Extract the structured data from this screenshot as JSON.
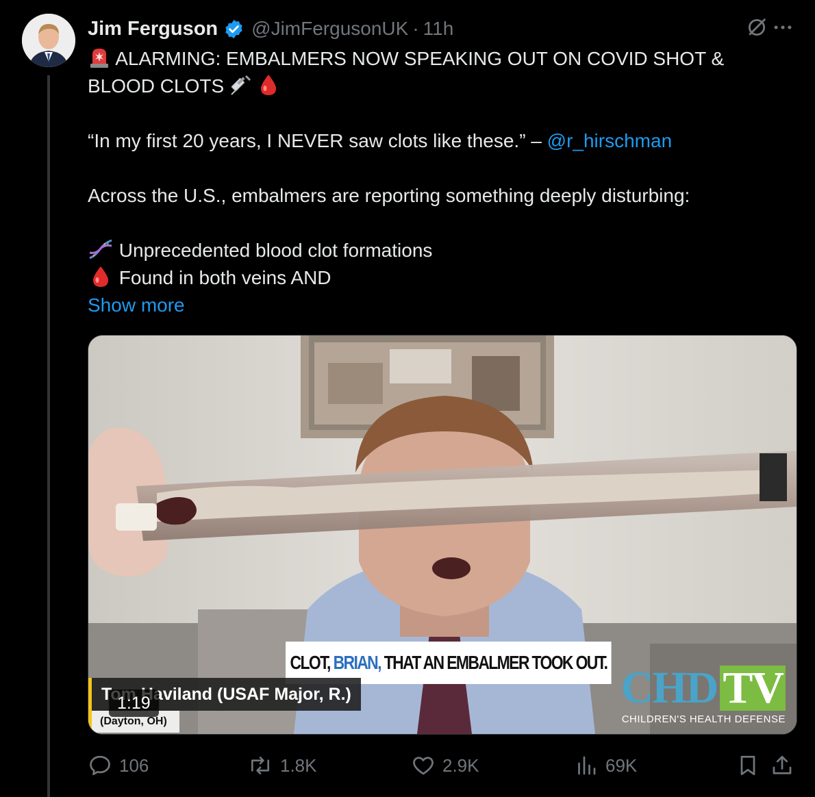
{
  "author": {
    "name": "Jim Ferguson",
    "handle": "@JimFergusonUK",
    "separator": "·",
    "time": "11h",
    "verified": true
  },
  "tweet": {
    "headline_line1": "ALARMING: EMBALMERS NOW SPEAKING OUT ON COVID SHOT &",
    "headline_line2": "BLOOD CLOTS",
    "quote": "“In my first 20 years, I NEVER saw clots like these.” –",
    "quote_mention": "@r_hirschman",
    "paragraph": "Across the U.S., embalmers are reporting something deeply disturbing:",
    "bullet1": "Unprecedented blood clot formations",
    "bullet2": "Found in both veins AND",
    "show_more": "Show more",
    "emojis": [
      "rotating-light-icon",
      "syringe-icon",
      "drop-of-blood-icon",
      "dna-icon",
      "drop-of-blood-icon"
    ]
  },
  "media": {
    "caption_part1": "CLOT,",
    "caption_part2": "BRIAN,",
    "caption_part3": "THAT AN EMBALMER TOOK OUT.",
    "lower_third_name": "Tom Haviland (USAF Major, R.)",
    "lower_third_location": "(Dayton, OH)",
    "duration": "1:19",
    "logo_main": "CHD",
    "logo_tv": "TV",
    "logo_sub": "CHILDREN'S HEALTH DEFENSE"
  },
  "actions": {
    "replies": "106",
    "reposts": "1.8K",
    "likes": "2.9K",
    "views": "69K"
  },
  "colors": {
    "background": "#000000",
    "text": "#e7e9ea",
    "muted": "#71767b",
    "link": "#1d9bf0",
    "blood": "#e0245e"
  }
}
